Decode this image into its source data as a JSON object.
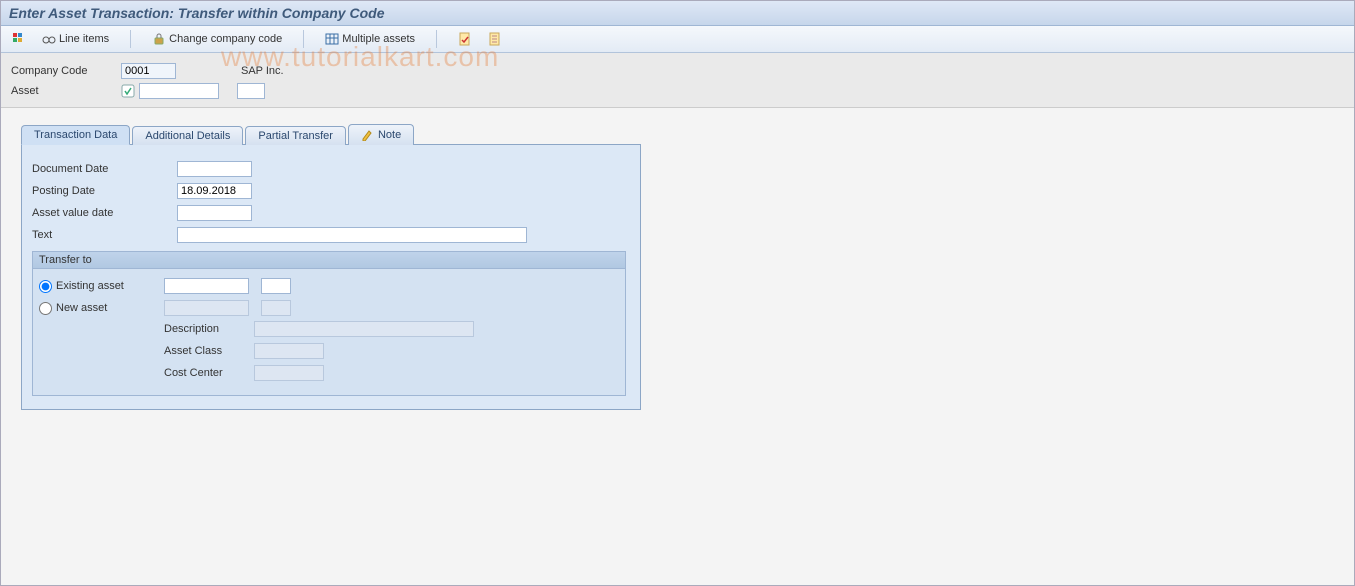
{
  "title": "Enter Asset Transaction: Transfer within Company Code",
  "toolbar": {
    "line_items": "Line items",
    "change_company": "Change company code",
    "multiple_assets": "Multiple assets"
  },
  "header": {
    "company_code_label": "Company Code",
    "company_code_value": "0001",
    "company_name": "SAP Inc.",
    "asset_label": "Asset",
    "asset_value": "",
    "asset_sub_value": ""
  },
  "tabs": {
    "transaction_data": "Transaction Data",
    "additional_details": "Additional Details",
    "partial_transfer": "Partial Transfer",
    "note": "Note"
  },
  "form": {
    "document_date_label": "Document Date",
    "document_date_value": "",
    "posting_date_label": "Posting Date",
    "posting_date_value": "18.09.2018",
    "asset_value_date_label": "Asset value date",
    "asset_value_date_value": "",
    "text_label": "Text",
    "text_value": ""
  },
  "transfer": {
    "group_title": "Transfer to",
    "existing_asset": "Existing asset",
    "new_asset": "New asset",
    "description_label": "Description",
    "description_value": "",
    "asset_class_label": "Asset Class",
    "asset_class_value": "",
    "cost_center_label": "Cost Center",
    "cost_center_value": "",
    "existing_asset_value": "",
    "existing_asset_sub": "",
    "new_asset_value": "",
    "new_asset_sub": ""
  },
  "watermark": "www.tutorialkart.com"
}
